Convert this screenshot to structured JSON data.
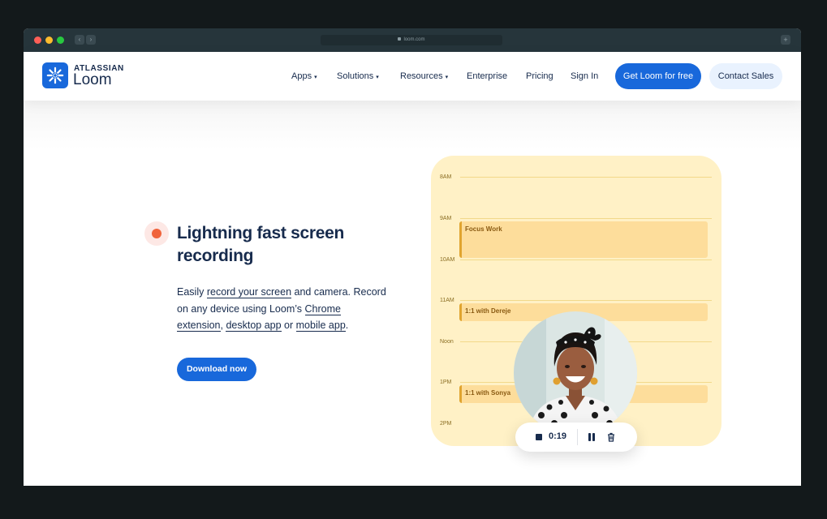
{
  "browser": {
    "url": "loom.com"
  },
  "brand": {
    "company": "ATLASSIAN",
    "product": "Loom"
  },
  "nav": {
    "items": [
      {
        "label": "Apps",
        "has_caret": true
      },
      {
        "label": "Solutions",
        "has_caret": true
      },
      {
        "label": "Resources",
        "has_caret": true
      },
      {
        "label": "Enterprise",
        "has_caret": false
      },
      {
        "label": "Pricing",
        "has_caret": false
      },
      {
        "label": "Sign In",
        "has_caret": false
      }
    ],
    "cta_primary": "Get Loom for free",
    "cta_secondary": "Contact Sales",
    "caret_glyph": "▾"
  },
  "hero": {
    "headline": "Lightning fast screen recording",
    "description": {
      "t1": "Easily ",
      "link1": "record your screen",
      "t2": " and camera. Record on any device using Loom’s ",
      "link2": "Chrome extension",
      "t3": ", ",
      "link3": "desktop app",
      "t4": " or ",
      "link4": "mobile app",
      "t5": "."
    },
    "download_label": "Download now"
  },
  "calendar": {
    "hours": [
      "8AM",
      "9AM",
      "10AM",
      "11AM",
      "Noon",
      "1PM",
      "2PM"
    ],
    "events": [
      {
        "label": "Focus Work"
      },
      {
        "label": "1:1 with Dereje"
      },
      {
        "label": "1:1 with Sonya"
      }
    ]
  },
  "recorder": {
    "timer": "0:19"
  },
  "colors": {
    "brand_blue": "#1868db",
    "record_orange": "#f0643c",
    "calendar_bg": "#fff1c6",
    "event_bg": "#fddd9b"
  }
}
